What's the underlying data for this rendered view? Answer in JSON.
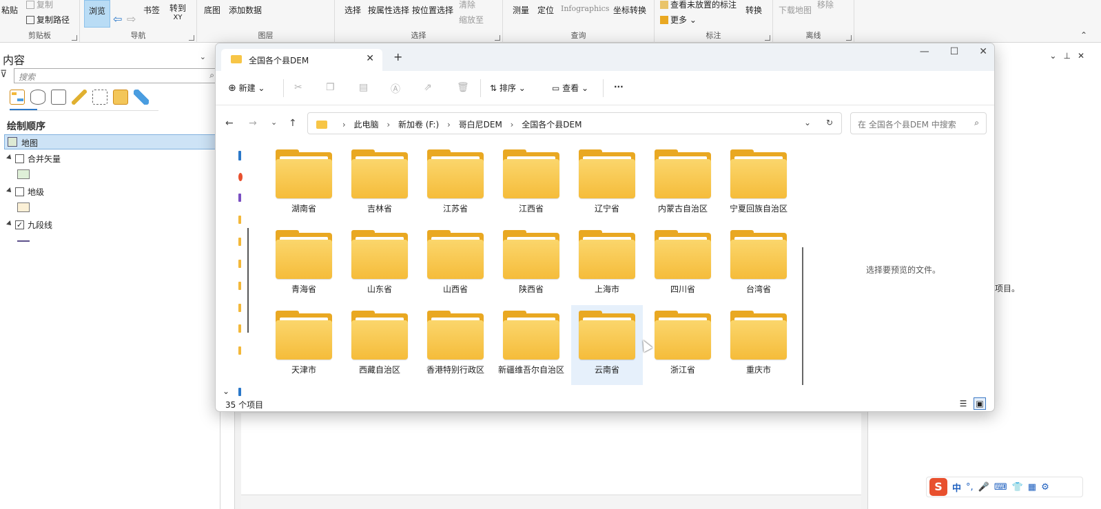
{
  "ribbon": {
    "groups": {
      "clipboard": "剪贴板",
      "navigate": "导航",
      "layer": "图层",
      "selection": "选择",
      "inquiry": "查询",
      "labeling": "标注",
      "offline": "离线"
    },
    "buttons": {
      "paste": "粘贴",
      "copy": "复制",
      "copy_path": "复制路径",
      "explore": "浏览",
      "bookmarks": "书签",
      "goto": "转到",
      "goto_sub": "XY",
      "basemap": "底图",
      "add_data": "添加数据",
      "select": "选择",
      "select_by_attr": "按属性选择",
      "select_by_loc": "按位置选择",
      "clear": "清除",
      "zoom_to": "缩放至",
      "measure": "测量",
      "locate": "定位",
      "infographics": "Infographics",
      "convert_coords": "坐标转换",
      "view_unplaced": "查看未放置的标注",
      "more": "更多",
      "convert": "转换",
      "download_map": "下载地图",
      "remove": "移除"
    }
  },
  "contents": {
    "title": "内容",
    "search_placeholder": "搜索",
    "drawing_order": "绘制顺序",
    "map": "地图",
    "layers": [
      {
        "name": "合并矢量",
        "checked": false,
        "swatch": "#dff0d8"
      },
      {
        "name": "地级",
        "checked": false,
        "swatch": "#fbf0d6"
      },
      {
        "name": "九段线",
        "checked": true,
        "swatch": "#5b4f8a"
      }
    ]
  },
  "right_pane": {
    "text": "择项目。"
  },
  "explorer": {
    "tab_title": "全国各个县DEM",
    "new_tab": "+",
    "commands": {
      "new": "新建",
      "sort": "排序",
      "view": "查看",
      "more": "···"
    },
    "breadcrumb": [
      "此电脑",
      "新加卷 (F:)",
      "哥白尼DEM",
      "全国各个县DEM"
    ],
    "search_placeholder": "在 全国各个县DEM 中搜索",
    "folders": [
      "湖南省",
      "吉林省",
      "江苏省",
      "江西省",
      "辽宁省",
      "内蒙古自治区",
      "宁夏回族自治区",
      "青海省",
      "山东省",
      "山西省",
      "陕西省",
      "上海市",
      "四川省",
      "台湾省",
      "天津市",
      "西藏自治区",
      "香港特别行政区",
      "新疆维吾尔自治区",
      "云南省",
      "浙江省",
      "重庆市"
    ],
    "selected_folder": "云南省",
    "preview_text": "选择要预览的文件。",
    "status": "35 个项目"
  },
  "ime": {
    "label": "中"
  },
  "colors": {
    "accent": "#2b78c9",
    "folder": "#f5bc3a",
    "selection": "#cde3f6"
  }
}
